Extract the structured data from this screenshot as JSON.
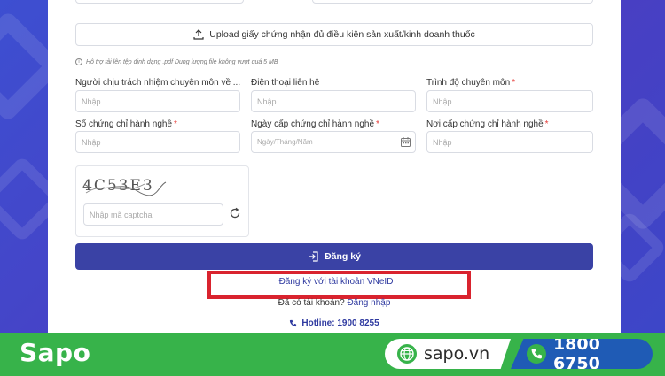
{
  "form": {
    "upload_label": "Upload giấy chứng nhận đủ điều kiện sản xuất/kinh doanh thuốc",
    "upload_hint": "Hỗ trợ tải lên tệp định dạng .pdf Dung lượng file không vượt quá 5 MB",
    "fields": {
      "responsible_person": {
        "label": "Người chịu trách nhiệm chuyên môn về ...",
        "placeholder": "Nhập"
      },
      "phone": {
        "label": "Điện thoại liên hệ",
        "placeholder": "Nhập"
      },
      "qualification": {
        "label": "Trình độ chuyên môn",
        "required": "*",
        "placeholder": "Nhập"
      },
      "cert_number": {
        "label": "Số chứng chỉ hành nghề",
        "required": "*",
        "placeholder": "Nhập"
      },
      "cert_date": {
        "label": "Ngày cấp chứng chỉ hành nghề",
        "required": "*",
        "placeholder": "Ngày/Tháng/Năm"
      },
      "cert_place": {
        "label": "Nơi cấp chứng chỉ hành nghề",
        "required": "*",
        "placeholder": "Nhập"
      }
    },
    "captcha": {
      "code": "4C53E3",
      "placeholder": "Nhập mã captcha"
    },
    "submit_label": "Đăng ký",
    "vneid_link": "Đăng ký với tài khoản VNeID",
    "account_prompt": "Đã có tài khoản?",
    "login_link": "Đăng nhập",
    "hotline": "Hotline: 1900 8255"
  },
  "footer": {
    "brand": "Sapo",
    "site": "sapo.vn",
    "phone": "1800 6750"
  },
  "colors": {
    "primary": "#3a42a5",
    "link": "#2f3aa0",
    "highlight": "#d9232e",
    "footer_green": "#37b34a",
    "footer_blue": "#1f5bb5"
  }
}
